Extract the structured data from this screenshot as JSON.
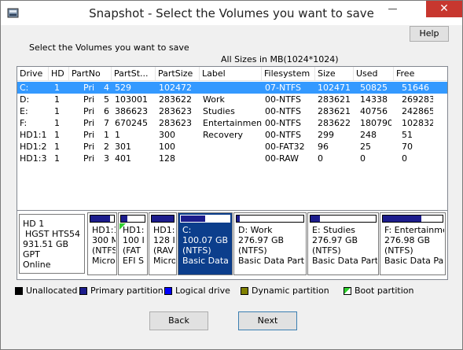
{
  "window": {
    "title": "Snapshot - Select the Volumes you want to save",
    "minimize": "—",
    "close": "✕"
  },
  "help_label": "Help",
  "instruction": "Select the Volumes you want to save",
  "sizes_note": "All Sizes in MB(1024*1024)",
  "table": {
    "columns": [
      "Drive",
      "HD",
      "PartNo",
      "PartSt...",
      "PartSize",
      "Label",
      "Filesystem",
      "Size",
      "Used",
      "Free"
    ],
    "rows": [
      {
        "drive": "C:",
        "hd": "1",
        "type": "Pri",
        "partno": "4",
        "partstart": "529",
        "partsize": "102472",
        "label": "",
        "fs": "07-NTFS",
        "size": "102471",
        "used": "50825",
        "free": "51646",
        "selected": true
      },
      {
        "drive": "D:",
        "hd": "1",
        "type": "Pri",
        "partno": "5",
        "partstart": "103001",
        "partsize": "283622",
        "label": "Work",
        "fs": "00-NTFS",
        "size": "283621",
        "used": "14338",
        "free": "269283",
        "selected": false
      },
      {
        "drive": "E:",
        "hd": "1",
        "type": "Pri",
        "partno": "6",
        "partstart": "386623",
        "partsize": "283623",
        "label": "Studies",
        "fs": "00-NTFS",
        "size": "283621",
        "used": "40756",
        "free": "242865",
        "selected": false
      },
      {
        "drive": "F:",
        "hd": "1",
        "type": "Pri",
        "partno": "7",
        "partstart": "670245",
        "partsize": "283623",
        "label": "Entertainment",
        "fs": "00-NTFS",
        "size": "283622",
        "used": "180790",
        "free": "102832",
        "selected": false
      },
      {
        "drive": "HD1:1",
        "hd": "1",
        "type": "Pri",
        "partno": "1",
        "partstart": "1",
        "partsize": "300",
        "label": "Recovery",
        "fs": "00-NTFS",
        "size": "299",
        "used": "248",
        "free": "51",
        "selected": false
      },
      {
        "drive": "HD1:2",
        "hd": "1",
        "type": "Pri",
        "partno": "2",
        "partstart": "301",
        "partsize": "100",
        "label": "",
        "fs": "00-FAT32",
        "size": "96",
        "used": "25",
        "free": "70",
        "selected": false
      },
      {
        "drive": "HD1:3",
        "hd": "1",
        "type": "Pri",
        "partno": "3",
        "partstart": "401",
        "partsize": "128",
        "label": "",
        "fs": "00-RAW",
        "size": "0",
        "used": "0",
        "free": "0",
        "selected": false
      }
    ]
  },
  "disk": {
    "name": "HD 1",
    "model": "HGST HTS54",
    "capacity": "931.51 GB",
    "style": "GPT",
    "status": "Online",
    "partitions": [
      {
        "lines": [
          "HD1:1",
          "300 M",
          "(NTFS",
          "Micros"
        ],
        "used_fraction": 0.83,
        "boot": false,
        "selected": false
      },
      {
        "lines": [
          "HD1:",
          "100 I",
          "(FAT",
          "EFI S"
        ],
        "used_fraction": 0.26,
        "boot": true,
        "selected": false
      },
      {
        "lines": [
          "HD1:",
          "128 I",
          "(RAV",
          "Micro"
        ],
        "used_fraction": 1.0,
        "boot": false,
        "selected": false
      },
      {
        "lines": [
          "C:",
          "100.07 GB",
          "(NTFS)",
          "Basic Data F"
        ],
        "used_fraction": 0.5,
        "boot": false,
        "selected": true
      },
      {
        "lines": [
          "D: Work",
          "276.97 GB",
          "(NTFS)",
          "Basic Data Partition"
        ],
        "used_fraction": 0.05,
        "boot": false,
        "selected": false
      },
      {
        "lines": [
          "E: Studies",
          "276.97 GB",
          "(NTFS)",
          "Basic Data Partition"
        ],
        "used_fraction": 0.14,
        "boot": false,
        "selected": false
      },
      {
        "lines": [
          "F: Entertainment",
          "276.98 GB",
          "(NTFS)",
          "Basic Data Partition"
        ],
        "used_fraction": 0.64,
        "boot": false,
        "selected": false
      }
    ]
  },
  "legend": [
    {
      "label": "Unallocated",
      "color": "#000000"
    },
    {
      "label": "Primary partition",
      "color": "#1c1c8c"
    },
    {
      "label": "Logical drive",
      "color": "#0000ff"
    },
    {
      "label": "Dynamic partition",
      "color": "#808000"
    },
    {
      "label": "Boot partition",
      "color": "#2fcf2f"
    }
  ],
  "buttons": {
    "back": "Back",
    "next": "Next"
  }
}
